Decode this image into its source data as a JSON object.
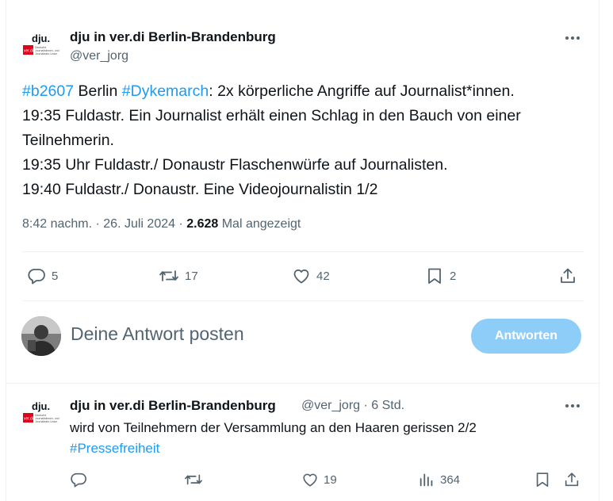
{
  "main_tweet": {
    "author_name": "dju in ver.di Berlin-Brandenburg",
    "handle": "@ver_jorg",
    "text_lines": [
      [
        {
          "t": "#b2607",
          "tag": true
        },
        {
          "t": " Berlin ",
          "tag": false
        },
        {
          "t": "#Dykemarch",
          "tag": true
        },
        {
          "t": ": 2x körperliche Angriffe auf Journalist*innen.",
          "tag": false
        }
      ],
      [
        {
          "t": "19:35 Fuldastr. Ein Journalist erhält einen Schlag in den Bauch von einer",
          "tag": false
        }
      ],
      [
        {
          "t": "Teilnehmerin.",
          "tag": false
        }
      ],
      [
        {
          "t": "19:35 Uhr Fuldastr./ Donaustr Flaschenwürfe auf Journalisten.",
          "tag": false
        }
      ],
      [
        {
          "t": "19:40 Fuldastr./ Donaustr. Eine Videojournalistin 1/2",
          "tag": false
        }
      ]
    ],
    "time": "8:42 nachm.",
    "separator": " · ",
    "date": "26. Juli 2024",
    "views_count": "2.628",
    "views_label": " Mal angezeigt",
    "replies": "5",
    "reposts": "17",
    "likes": "42",
    "bookmarks": "2"
  },
  "reply_box": {
    "placeholder": "Deine Antwort posten",
    "button_label": "Antworten"
  },
  "reply_tweet": {
    "author_name": "dju in ver.di Berlin-Brandenburg",
    "handle_time": "@ver_jorg · 6 Std.",
    "text": "wird von Teilnehmern der Versammlung an den Haaren gerissen 2/2",
    "hashtag": "#Pressefreiheit",
    "likes": "19",
    "views": "364"
  },
  "logo": {
    "brand_text": "dju.",
    "badge_text": "ver.di",
    "small_lines": [
      "Deutsche",
      "Journalistinnen- und",
      "Journalisten-Union"
    ],
    "brand_color": "#e2001a"
  },
  "colors": {
    "accent": "#1d9bf0",
    "secondary_text": "#536471",
    "button_disabled": "#8ecdf7"
  },
  "icons": [
    "more-icon",
    "reply-icon",
    "repost-icon",
    "like-icon",
    "bookmark-icon",
    "share-icon",
    "views-icon"
  ]
}
